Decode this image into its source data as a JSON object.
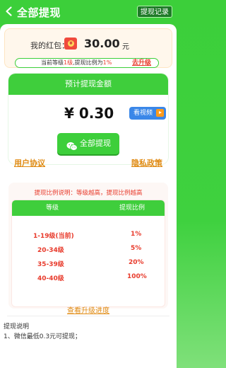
{
  "header": {
    "title": "全部提现",
    "record_label": "提现记录"
  },
  "wallet": {
    "label": "我的红包：",
    "amount": "30.00",
    "unit": "元",
    "level_prefix": "当前等级",
    "level_value": "1级",
    "ratio_prefix": ",提现比例为",
    "ratio_value": "1%",
    "upgrade_label": "去升级"
  },
  "estimate": {
    "header": "预计提现金额",
    "price": "¥ 0.30",
    "video_label": "看视频",
    "withdraw_label": "全部提现"
  },
  "links": {
    "agreement": "用户协议",
    "privacy": "隐私政策"
  },
  "ratio": {
    "note": "提现比例说明：等级越高，提现比例越高",
    "headers": [
      "等级",
      "提现比例"
    ],
    "rows": [
      {
        "level": "1-19级(当前)",
        "ratio": "1%"
      },
      {
        "level": "20-34级",
        "ratio": "5%"
      },
      {
        "level": "35-39级",
        "ratio": "20%"
      },
      {
        "level": "40-40级",
        "ratio": "100%"
      }
    ]
  },
  "progress_link": "查看升级进度",
  "notes": {
    "title": "提现说明",
    "items": [
      "1、微信最低0.3元可提现；"
    ]
  },
  "colors": {
    "brand_green": "#3fce3c",
    "accent_red": "#e83b2c",
    "link_orange": "#e08a12",
    "video_blue": "#3a87e8"
  }
}
